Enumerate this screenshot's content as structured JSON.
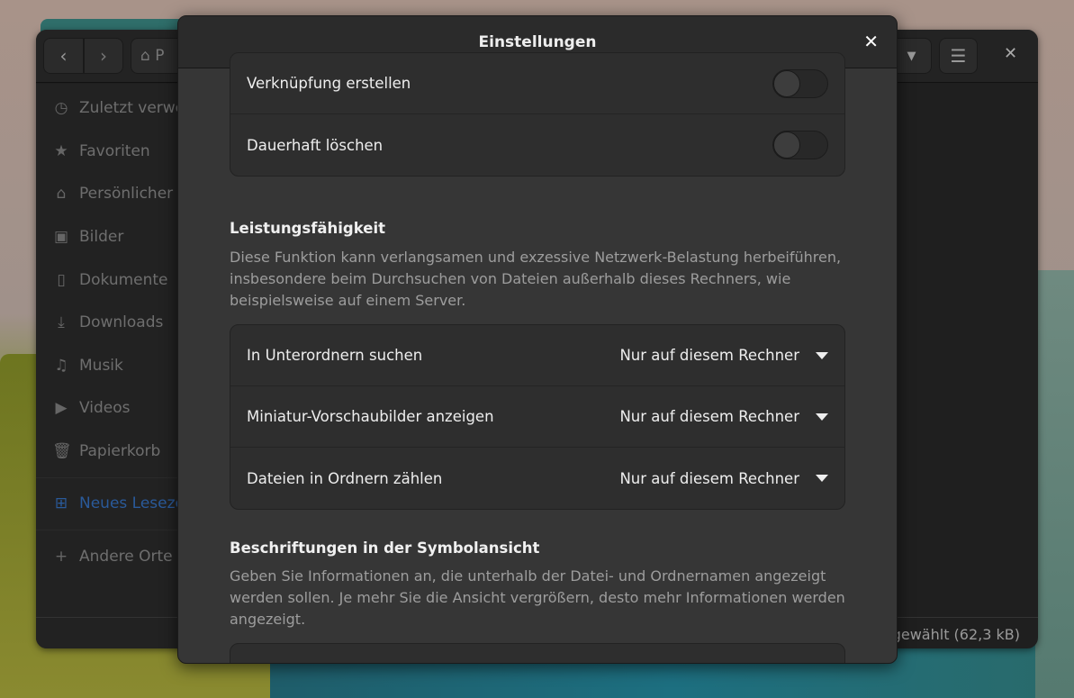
{
  "file_manager": {
    "path_label": "P",
    "status": "gewählt  (62,3 kB)",
    "sidebar": [
      {
        "icon": "clock-icon",
        "glyph": "◷",
        "label": "Zuletzt verwendet"
      },
      {
        "icon": "star-icon",
        "glyph": "★",
        "label": "Favoriten"
      },
      {
        "icon": "home-icon",
        "glyph": "⌂",
        "label": "Persönlicher Ordner"
      },
      {
        "icon": "image-icon",
        "glyph": "▣",
        "label": "Bilder"
      },
      {
        "icon": "document-icon",
        "glyph": "▯",
        "label": "Dokumente"
      },
      {
        "icon": "download-icon",
        "glyph": "⤓",
        "label": "Downloads"
      },
      {
        "icon": "music-icon",
        "glyph": "♫",
        "label": "Musik"
      },
      {
        "icon": "video-icon",
        "glyph": "▶",
        "label": "Videos"
      },
      {
        "icon": "trash-icon",
        "glyph": "🗑",
        "label": "Papierkorb"
      },
      {
        "icon": "bookmark-add-icon",
        "glyph": "⊞",
        "label": "Neues Lesezeichen"
      },
      {
        "icon": "plus-icon",
        "glyph": "+",
        "label": "Andere Orte"
      }
    ],
    "accent": "#2a5a9a"
  },
  "dialog": {
    "title": "Einstellungen",
    "toggles": [
      {
        "label": "Verknüpfung erstellen",
        "on": false
      },
      {
        "label": "Dauerhaft löschen",
        "on": false
      }
    ],
    "performance": {
      "heading": "Leistungsfähigkeit",
      "description": "Diese Funktion kann verlangsamen und exzessive Netzwerk-Belastung herbeiführen, insbesondere beim Durchsuchen von Dateien außerhalb dieses Rechners, wie beispielsweise auf einem Server.",
      "rows": [
        {
          "label": "In Unterordnern suchen",
          "value": "Nur auf diesem Rechner"
        },
        {
          "label": "Miniatur-Vorschaubilder anzeigen",
          "value": "Nur auf diesem Rechner"
        },
        {
          "label": "Dateien in Ordnern zählen",
          "value": "Nur auf diesem Rechner"
        }
      ]
    },
    "captions": {
      "heading": "Beschriftungen in der Symbolansicht",
      "description": "Geben Sie Informationen an, die unterhalb der Datei- und Ordnernamen angezeigt werden sollen. Je mehr Sie die Ansicht vergrößern, desto mehr Informationen werden angezeigt."
    }
  }
}
